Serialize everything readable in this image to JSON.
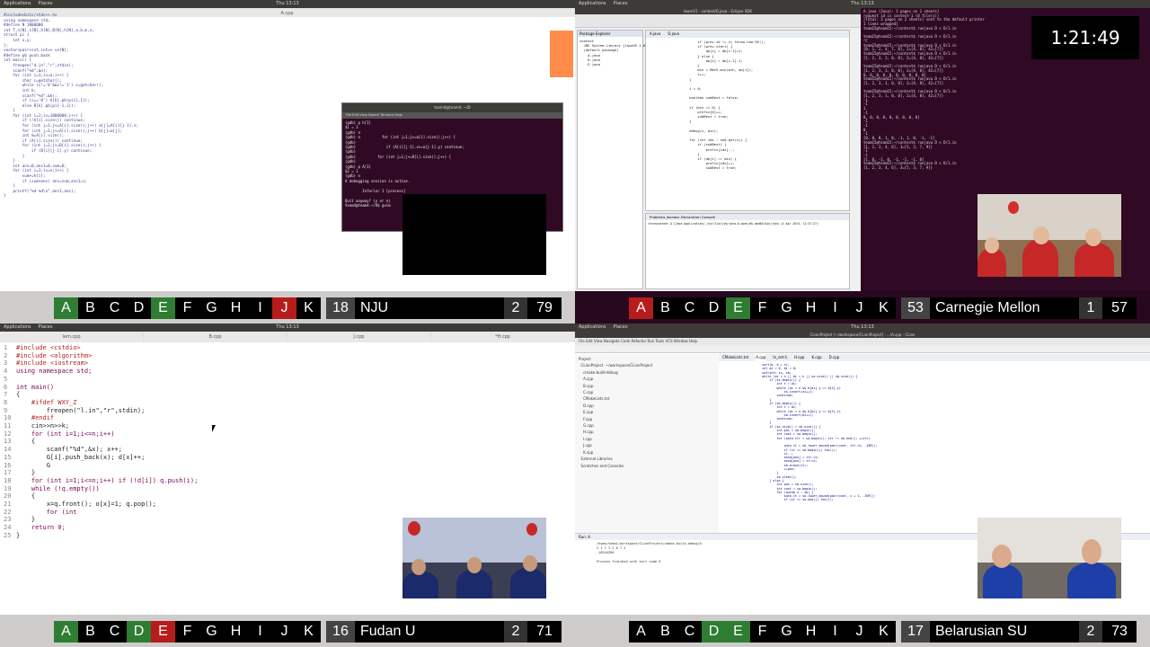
{
  "timer": "1:21:49",
  "topbar": {
    "menu": [
      "Applications",
      "Places"
    ],
    "clock": "Thu 13:13"
  },
  "quads": {
    "tl": {
      "tab_title": "A.cpp",
      "terminal_title": "team4@team4: ~/D",
      "terminal_menu": "File  Edit  View  Search  Terminal  Help",
      "code": "#include<bits/stdc++.h>\nusing namespace std;\n#define N 1000000\nint T,n[N],s[N],A[N],B[N],h[N],a,b,m,n;\nstruct pi {\n    int x,y;\n};\nvector<pair<int,int>> ve[N];\n#define pb push_back\nint main() {\n    freopen(\"d.in\",\"r\",stdin);\n    scanf(\"%d\",&n);\n    for (int i=1;i<=n;i++) {\n        char c=getchar();\n        while (c!='0'&&c!='1') c=getchar();\n        int k;\n        scanf(\"%d\",&k);\n        if (c=='0') A[k].pb(pi{i,1});\n        else B[k].pb(pi{-1,i});\n    }\n    for (int i=1;i<=1000000;i++) {\n        if (!A[i].size()) continue;\n        for (int j=1;j<=A[i].size();j++) a[j]=A[i][j-1].x;\n        for (int j=1;j<=A[i].size();j++) b[j]=a[j];\n        int m=A[i].size();\n        if (A[i].size()) continue;\n        for (int j=1;j<=B[i].size();j++) {\n            if (B[i][j-1].y) continue;\n        }\n    }\n    int ans=0,ans1=0,sum=0;\n    for (int i=1;i<=n;i++) {\n        sum+=h[i];\n        if (sum>ans) ans=sum,ans1=i;\n    }\n    printf(\"%d %d\\n\",ans1,ans);\n}",
      "terminal": "(gdb) p h[1]\n$1 = 1\n(gdb) n\n(gdb) n          for (int j=1;j<=a[i].size();j++) {\n(gdb)\n(gdb)              if (A[i][j-1].x>=a[j-1].y) continue;\n(gdb)\n(gdb)          for (int j=1;j<=B[i].size();j++) {\n(gdb)\n(gdb) p A[1]\n$2 = 1\n(gdb) n\nA debugging session is active.\n\n        Inferior 1 [process]\n\nQuit anyway? (y or n)\nteam4@team4:~/D$ gvim"
    },
    "tr": {
      "title": "team15 - contest/D.java - Eclipse SDK",
      "explorer_title": "Package Explorer",
      "explorer": "contest\n  JRE System Library [JavaSE-1.8]\n  (default package)\n    A.java\n    D.java\n    E.java",
      "editor_tabs": [
        "A.java",
        "D.java"
      ],
      "code": "            if (prev.id != x) throw new RE();\n            if (prev.start) {\n                dp[i] = dp[i-1]+1;\n            } else {\n                dp[i] = dp[i-1]-1;\n            }\n            min = Math.min(min, dp[i]);\n            i++;\n        }\n\n        i = 0;\n\n        boolean subBest = false;\n\n        if (min == 0) {\n            prefix[0]++;\n            subBest = true;\n        }\n\n        debug(x, min);\n\n        for (int idx : seq.get(x)) {\n            if (subBest) {\n                prefix[idx]--;\n            }\n            if (dp[i] == min) {\n                prefix[idx]++;\n                subBest = true;",
      "console_tabs": "Problems  Javadoc  Declaration  Console",
      "console": "<terminated> A [Java Application] /usr/lib/jvm/java-8-openjdk-amd64/bin/java (4 Apr 2019, 12:47:27)",
      "terminal": "A.java (Java): 3 pages on 2 sheets]\nrequest id is contest-1 (0 file(s))\n[Total: 3 pages on 2 sheets] sent to the default printer\n1 lines wrapped]\nteam15@team15:~/contest$ runjava D < D/1.in\n\nteam15@team15:~/contest$ runjava D < D/1.in\n^C\nteam15@team15:~/contest$ runjava D < D/1.in\n[0, 1, 2, 4, 7, 8], 2=[4, 8], 42=[7]}\nteam15@team15:~/contest$ runjava D < D/1.in\n[1, 2, 3, 1, 0, 0], 2=[4, 8], 42=[7]}\n\nteam15@team15:~/contest$ runjava D < D/1.in\n[1, 2, 3, 1, 0, 0], 2=[4, 8], 42=[7]}\n0, 0, 0, 0, 0, 0, 0, 0, 0, 0]\nteam15@team15:~/contest$ runjava D < D/1.in\n[1, 2, 3, 1, 0, 0], 2=[4, 8], 42=[7]}\n\nteam15@team15:~/contest$ runjava D < D/1.in\n[1, 2, 3, 1, 0, 0], 2=[4, 8], 42=[7]}\n-1\n-1\n1\n-1\n0, 0, 0, 0, 0, 0, 0, 0, 0]\n-1\n-1\n0\n-1\n[0, 0, 0, 1, 0, -1, 1, 0, -1, -1]\nteam15@team15:~/contest$ runjava D < D/1.in\n[1, 2, 3, 4, 6], 3=[5, 3, 7, 9]}\n-1\n-1\n[1, 0, -1, 0, -1, -1, -1, 0]\nteam15@team15:~/contest$ runjava D < D/1.in\n[1, 2, 3, 4, 6], 3=[5, 3, 7, 9]}"
    },
    "bl": {
      "tabs": [
        "lem.cpp",
        "B.cpp",
        "J.cpp",
        "*H.cpp"
      ],
      "code": [
        {
          "n": "1",
          "t": "#include <cstdio>"
        },
        {
          "n": "2",
          "t": "#include <algorithm>"
        },
        {
          "n": "3",
          "t": "#include <iostream>"
        },
        {
          "n": "4",
          "t": "using namespace std;"
        },
        {
          "n": "5",
          "t": ""
        },
        {
          "n": "6",
          "t": "int main()"
        },
        {
          "n": "7",
          "t": "{"
        },
        {
          "n": "8",
          "t": "    #ifdef WXY_Z"
        },
        {
          "n": "9",
          "t": "        freopen(\"l.in\",\"r\",stdin);"
        },
        {
          "n": "10",
          "t": "    #endif"
        },
        {
          "n": "11",
          "t": "    cin>>n>>k;"
        },
        {
          "n": "12",
          "t": "    for (int i=1;i<=n;i++)"
        },
        {
          "n": "13",
          "t": "    {"
        },
        {
          "n": "14",
          "t": "        scanf(\"%d\",&x); x++;"
        },
        {
          "n": "15",
          "t": "        G[i].push_back(x); d[x]++;"
        },
        {
          "n": "16",
          "t": "        G"
        },
        {
          "n": "17",
          "t": "    }"
        },
        {
          "n": "18",
          "t": "    for (int i=1;i<=n;i++) if (!d[i]) q.push(i);"
        },
        {
          "n": "19",
          "t": "    while (!q.empty())"
        },
        {
          "n": "20",
          "t": "    {"
        },
        {
          "n": "21",
          "t": "        x=q.front(); o[x]=1; q.pop();"
        },
        {
          "n": "22",
          "t": "        for (int"
        },
        {
          "n": "23",
          "t": "    }"
        },
        {
          "n": "24",
          "t": "    return 0;"
        },
        {
          "n": "25",
          "t": "}"
        }
      ]
    },
    "br": {
      "title": "CLionProject [~/workspace/CLionProject] - .../A.cpp - CLion",
      "menu": "File  Edit  View  Navigate  Code  Refactor  Run  Tools  VCS  Window  Help",
      "tree": "Project\n  CLionProject  ~/workspace/CLionProject\n    cmake-build-debug\n    A.cpp\n    B.cpp\n    C.cpp\n    CMakeLists.txt\n    D.cpp\n    E.cpp\n    F.cpp\n    G.cpp\n    H.cpp\n    I.cpp\n    J.cpp\n    K.cpp\n  External Libraries\n  Scratches and Consoles",
      "editor_tabs": [
        "CMakeLists.txt",
        "A.cpp",
        "ts_set.h",
        "H.cpp",
        "K.cpp",
        "D.cpp"
      ],
      "code": "    sort(b, b + n);\n    int ai = 0, bi = 0;\n    set<int> ss, sb;\n    while (ai < n || bi < n || sa.size() || sb.size()) {\n        if (ss.empty()) {\n            int t = ai;\n            while (ai < n && b[ai].y == b[t].y)\n                ss.insert(ai++);\n            continue;\n        }\n        if (sb.empty()) {\n            int t = bi;\n            while (bi < n && b[bi].y == b[t].y)\n                sb.insert(bi++);\n            continue;\n        }\n        if (ss.size() < sb.size()) {\n            int pos = sb.begin();\n            int cost = sa.begin();\n            for (auto itr = sa.begin(); itr != sa.end(); ++itr)\n\n                auto it = sb.lower_bound(pair(cost, itr->x, -INF));\n                if (it == sb.begin()) fail();\n                it--;\n                ansa[pos] = itr->x;\n                ansb[pos] = it->x;\n                sb.erase(it);\n                ++pos;\n            }\n            sa.clear();\n        } else {\n            int pos = sb.size();\n            int cost = sa.begin();\n            for (auto& x : sb) {\n                auto it = sa.lower_bound(pair(cost, x + 1, -INF));\n                if (it == sa.end()) fail();",
      "run_title": "Run:  A",
      "run": "/home/team1/workspace/CLionProject/cmake-build-debug/A\n2 1 7 3 2 0 7 2\n-18244356\n\nProcess finished with exit code 0"
    }
  },
  "scoreboards": [
    {
      "quad": "tl",
      "rank": "18",
      "team": "NJU",
      "solved": "2",
      "penalty": "79",
      "problems": [
        {
          "letter": "A",
          "status": "solved"
        },
        {
          "letter": "B",
          "status": "none"
        },
        {
          "letter": "C",
          "status": "none"
        },
        {
          "letter": "D",
          "status": "none"
        },
        {
          "letter": "E",
          "status": "solved"
        },
        {
          "letter": "F",
          "status": "none"
        },
        {
          "letter": "G",
          "status": "none"
        },
        {
          "letter": "H",
          "status": "none"
        },
        {
          "letter": "I",
          "status": "none"
        },
        {
          "letter": "J",
          "status": "rejected"
        },
        {
          "letter": "K",
          "status": "none"
        }
      ]
    },
    {
      "quad": "tr",
      "rank": "53",
      "team": "Carnegie Mellon",
      "solved": "1",
      "penalty": "57",
      "problems": [
        {
          "letter": "A",
          "status": "rejected"
        },
        {
          "letter": "B",
          "status": "none"
        },
        {
          "letter": "C",
          "status": "none"
        },
        {
          "letter": "D",
          "status": "none"
        },
        {
          "letter": "E",
          "status": "solved"
        },
        {
          "letter": "F",
          "status": "none"
        },
        {
          "letter": "G",
          "status": "none"
        },
        {
          "letter": "H",
          "status": "none"
        },
        {
          "letter": "I",
          "status": "none"
        },
        {
          "letter": "J",
          "status": "none"
        },
        {
          "letter": "K",
          "status": "none"
        }
      ]
    },
    {
      "quad": "bl",
      "rank": "16",
      "team": "Fudan U",
      "solved": "2",
      "penalty": "71",
      "problems": [
        {
          "letter": "A",
          "status": "solved"
        },
        {
          "letter": "B",
          "status": "none"
        },
        {
          "letter": "C",
          "status": "none"
        },
        {
          "letter": "D",
          "status": "solved"
        },
        {
          "letter": "E",
          "status": "rejected"
        },
        {
          "letter": "F",
          "status": "none"
        },
        {
          "letter": "G",
          "status": "none"
        },
        {
          "letter": "H",
          "status": "none"
        },
        {
          "letter": "I",
          "status": "none"
        },
        {
          "letter": "J",
          "status": "none"
        },
        {
          "letter": "K",
          "status": "none"
        }
      ]
    },
    {
      "quad": "br",
      "rank": "17",
      "team": "Belarusian SU",
      "solved": "2",
      "penalty": "73",
      "problems": [
        {
          "letter": "A",
          "status": "none"
        },
        {
          "letter": "B",
          "status": "none"
        },
        {
          "letter": "C",
          "status": "none"
        },
        {
          "letter": "D",
          "status": "solved"
        },
        {
          "letter": "E",
          "status": "solved"
        },
        {
          "letter": "F",
          "status": "none"
        },
        {
          "letter": "G",
          "status": "none"
        },
        {
          "letter": "H",
          "status": "none"
        },
        {
          "letter": "I",
          "status": "none"
        },
        {
          "letter": "J",
          "status": "none"
        },
        {
          "letter": "K",
          "status": "none"
        }
      ]
    }
  ],
  "colors": {
    "solved": "#2e7d32",
    "rejected": "#b71c1c",
    "none": "#000000",
    "terminal": "#300a24"
  }
}
